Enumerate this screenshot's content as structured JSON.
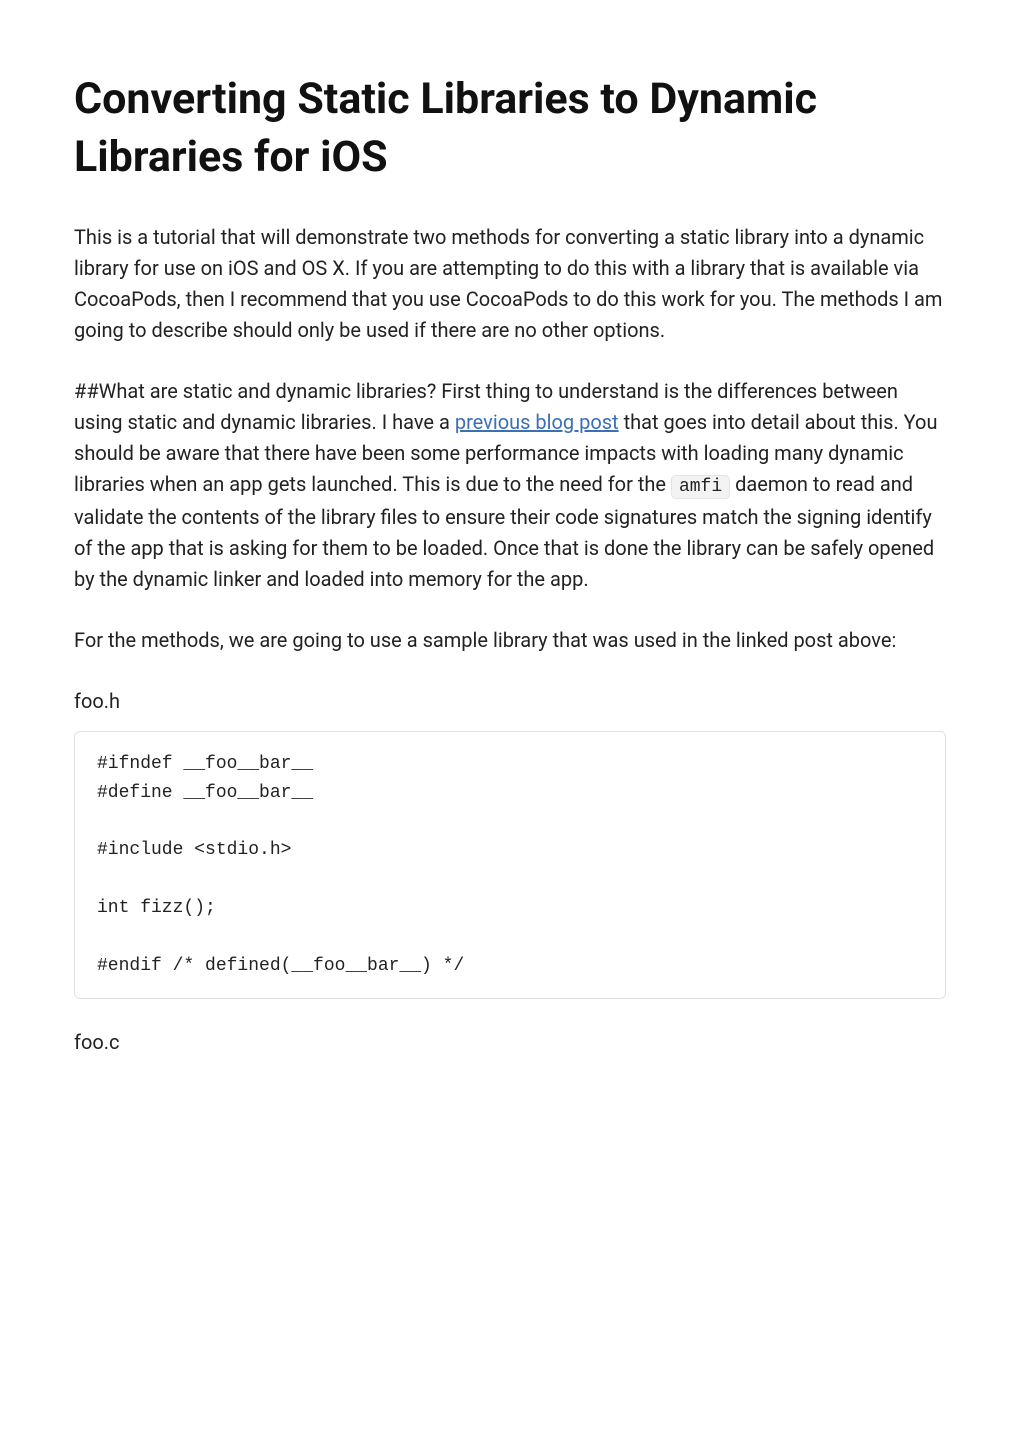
{
  "title": "Converting Static Libraries to Dynamic Libraries for iOS",
  "paragraphs": {
    "p1": "This is a tutorial that will demonstrate two methods for converting a static library into a dynamic library for use on iOS and OS X. If you are attempting to do this with a library that is available via CocoaPods, then I recommend that you use CocoaPods to do this work for you. The methods I am going to describe should only be used if there are no other options.",
    "p2_pre": "##What are static and dynamic libraries? First thing to understand is the differences between using static and dynamic libraries. I have a ",
    "p2_link": "previous blog post",
    "p2_mid": " that goes into detail about this. You should be aware that there have been some performance impacts with loading many dynamic libraries when an app gets launched. This is due to the need for the ",
    "p2_code": "amfi",
    "p2_post": " daemon to read and validate the contents of the library files to ensure their code signatures match the signing identify of the app that is asking for them to be loaded. Once that is done the library can be safely opened by the dynamic linker and loaded into memory for the app.",
    "p3": "For the methods, we are going to use a sample library that was used in the linked post above:"
  },
  "files": {
    "foo_h_label": "foo.h",
    "foo_h_code": "#ifndef __foo__bar__\n#define __foo__bar__\n\n#include <stdio.h>\n\nint fizz();\n\n#endif /* defined(__foo__bar__) */",
    "foo_c_label": "foo.c"
  }
}
